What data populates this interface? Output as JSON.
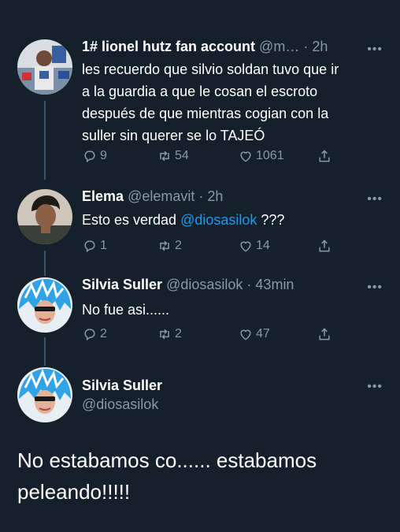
{
  "tweets": [
    {
      "name": "1# lionel hutz fan account",
      "handle": "@m…",
      "sep": "·",
      "time": "2h",
      "lines": [
        "les recuerdo que silvio soldan tuvo que ir",
        "a la guardia a que le cosan el escroto",
        "después de que mientras cogian con la",
        "suller sin querer se lo TAJEÓ"
      ],
      "replies": "9",
      "retweets": "54",
      "likes": "1061"
    },
    {
      "name": "Elema",
      "handle": "@elemavit",
      "sep": "·",
      "time": "2h",
      "text_before": "Esto es verdad ",
      "mention": "@diosasilok",
      "text_after": " ???",
      "replies": "1",
      "retweets": "2",
      "likes": "14"
    },
    {
      "name": "Silvia Suller",
      "handle": "@diosasilok",
      "sep": "·",
      "time": "43min",
      "text": "No fue asi......",
      "replies": "2",
      "retweets": "2",
      "likes": "47"
    }
  ],
  "focused": {
    "name": "Silvia Suller",
    "handle": "@diosasilok",
    "lines": [
      "No estabamos co...... estabamos",
      "peleando!!!!!"
    ]
  },
  "more_glyph": "•••",
  "colors": {
    "background": "#15202b",
    "muted": "#8899a6",
    "mention": "#1d9bf0",
    "text": "#ffffff"
  },
  "icons": [
    "reply-icon",
    "retweet-icon",
    "like-icon",
    "share-icon",
    "more-icon"
  ]
}
